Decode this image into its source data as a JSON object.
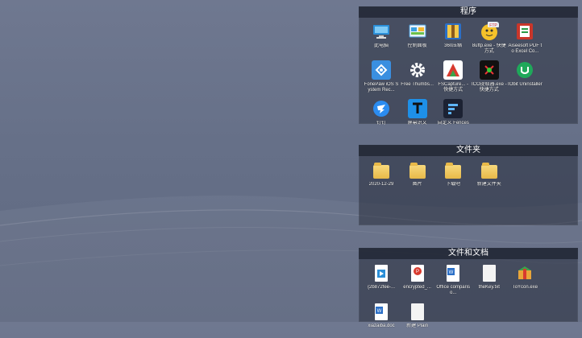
{
  "fences": {
    "programs": {
      "title": "程序",
      "items": [
        {
          "label": "此电脑",
          "icon": "computer-icon"
        },
        {
          "label": "控制面板",
          "icon": "control-panel-icon"
        },
        {
          "label": "360压缩",
          "icon": "archive-360-icon"
        },
        {
          "label": "8uftp.exe - 快捷方式",
          "icon": "ftp-icon"
        },
        {
          "label": "Aiseesoft PDF to Excel Co...",
          "icon": "pdf-excel-icon"
        },
        {
          "label": "FonePaw iOS System Rec...",
          "icon": "fonepaw-icon"
        },
        {
          "label": "Free Thumbs...",
          "icon": "gear-icon"
        },
        {
          "label": "FSCapture... - 快捷方式",
          "icon": "fscapture-icon"
        },
        {
          "label": "ICO提取器.exe - 快捷方式",
          "icon": "ico-extractor-icon"
        },
        {
          "label": "IObit Uninstaller",
          "icon": "iobit-icon"
        },
        {
          "label": "钉钉",
          "icon": "dingtalk-icon"
        },
        {
          "label": "屏幕识文",
          "icon": "screen-text-icon"
        },
        {
          "label": "自定义 Fences",
          "icon": "fences-icon"
        }
      ]
    },
    "folders": {
      "title": "文件夹",
      "items": [
        {
          "label": "2020-12-29",
          "icon": "folder-icon"
        },
        {
          "label": "图片",
          "icon": "folder-icon"
        },
        {
          "label": "下载吧",
          "icon": "folder-icon"
        },
        {
          "label": "新建文件夹",
          "icon": "folder-icon"
        }
      ]
    },
    "documents": {
      "title": "文件和文档",
      "items": [
        {
          "label": "{2b872fee-...",
          "icon": "media-file-icon"
        },
        {
          "label": "encrypted_...",
          "icon": "pdf-file-icon"
        },
        {
          "label": "Office compariso...",
          "icon": "word-doc-icon"
        },
        {
          "label": "theKey.txt",
          "icon": "text-file-icon"
        },
        {
          "label": "ToYcon.exe",
          "icon": "toycon-icon"
        },
        {
          "label": "xiazaiba.doc",
          "icon": "word-doc-icon"
        },
        {
          "label": "新建 Plain",
          "icon": "text-file-icon"
        }
      ]
    }
  }
}
